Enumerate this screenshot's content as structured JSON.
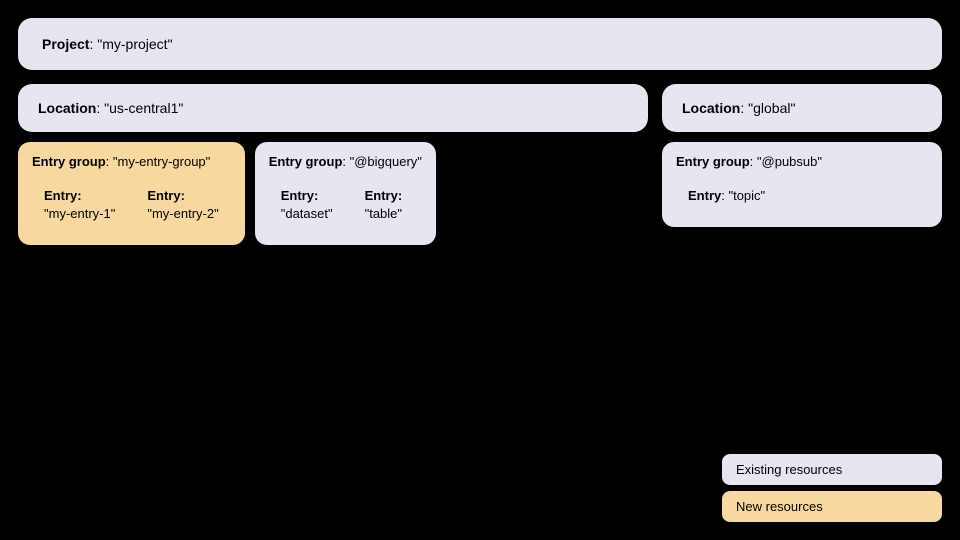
{
  "project": {
    "label": "Project",
    "value": "\"my-project\""
  },
  "locations": [
    {
      "id": "us-central1",
      "label": "Location",
      "value": "\"us-central1\"",
      "entryGroups": [
        {
          "id": "my-entry-group",
          "label": "Entry group",
          "value": "\"my-entry-group\"",
          "type": "new",
          "entries": [
            {
              "label": "Entry",
              "value": "\"my-entry-1\"",
              "type": "new"
            },
            {
              "label": "Entry",
              "value": "\"my-entry-2\"",
              "type": "new"
            }
          ]
        },
        {
          "id": "bigquery",
          "label": "Entry group",
          "value": "\"@bigquery\"",
          "type": "existing",
          "entries": [
            {
              "label": "Entry",
              "value": "\"dataset\"",
              "type": "existing"
            },
            {
              "label": "Entry",
              "value": "\"table\"",
              "type": "existing"
            }
          ]
        }
      ]
    },
    {
      "id": "global",
      "label": "Location",
      "value": "\"global\"",
      "entryGroups": [
        {
          "id": "pubsub",
          "label": "Entry group",
          "value": "\"@pubsub\"",
          "type": "existing",
          "entries": [
            {
              "label": "Entry",
              "value": "\"topic\"",
              "type": "existing"
            }
          ]
        }
      ]
    }
  ],
  "legend": {
    "existing_label": "Existing resources",
    "new_label": "New resources"
  }
}
